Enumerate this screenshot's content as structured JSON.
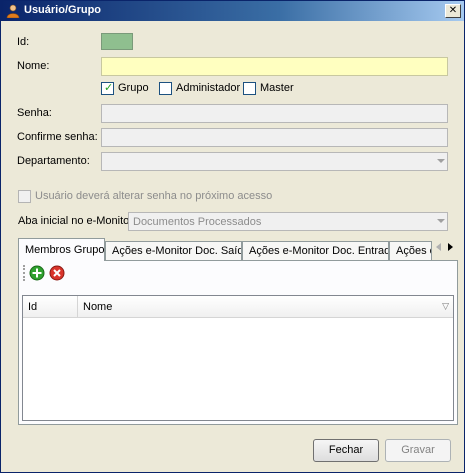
{
  "window": {
    "title": "Usuário/Grupo",
    "close_glyph": "✕"
  },
  "form": {
    "id_label": "Id:",
    "nome_label": "Nome:",
    "nome_value": "",
    "checkboxes": [
      {
        "label": "Grupo",
        "checked": true
      },
      {
        "label": "Administador",
        "checked": false
      },
      {
        "label": "Master",
        "checked": false
      }
    ],
    "senha_label": "Senha:",
    "confirme_label": "Confirme senha:",
    "departamento_label": "Departamento:",
    "alterar_senha_label": "Usuário deverá alterar senha no próximo acesso",
    "aba_inicial_label": "Aba inicial no e-Monitor:",
    "aba_inicial_value": "Documentos Processados"
  },
  "tabs": [
    {
      "label": "Membros Grupo",
      "active": true
    },
    {
      "label": "Ações e-Monitor Doc. Saída",
      "active": false
    },
    {
      "label": "Ações e-Monitor Doc. Entrada",
      "active": false
    },
    {
      "label": "Ações e-Monitor Doc. Servi",
      "active": false
    }
  ],
  "toolbar": {
    "add_icon": "add-icon",
    "remove_icon": "remove-icon"
  },
  "grid": {
    "columns": [
      "Id",
      "Nome"
    ],
    "rows": []
  },
  "buttons": {
    "fechar": "Fechar",
    "gravar": "Gravar"
  },
  "colors": {
    "id_box": "#8fbf8f",
    "nome_bg": "#ffffc0",
    "add": "#2fa12f",
    "remove": "#d9342b"
  }
}
